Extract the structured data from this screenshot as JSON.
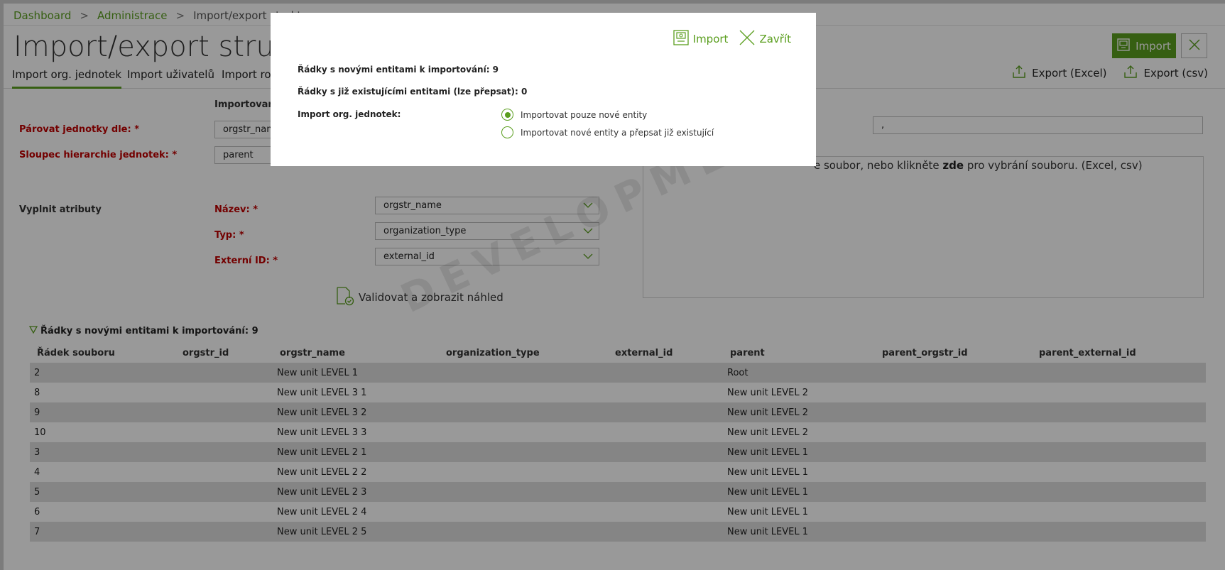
{
  "breadcrumb": {
    "items": [
      "Dashboard",
      "Administrace",
      "Import/export struktury"
    ],
    "separator": ">"
  },
  "page": {
    "title": "Import/export struktury"
  },
  "header_actions": {
    "import_label": "Import"
  },
  "tabs": [
    {
      "label": "Import org. jednotek",
      "active": true
    },
    {
      "label": "Import uživatelů",
      "active": false
    },
    {
      "label": "Import rolí",
      "active": false
    }
  ],
  "exports": {
    "excel_label": "Export (Excel)",
    "csv_label": "Export (csv)"
  },
  "form": {
    "importovany_label": "Importovaný",
    "match_label": "Párovat jednotky dle: *",
    "match_value": "orgstr_name",
    "hierarchy_label": "Sloupec hierarchie jednotek: *",
    "hierarchy_value": "parent",
    "separator_value": ",",
    "fill_attributes_label": "Vyplnit atributy",
    "name_label": "Název: *",
    "name_value": "orgstr_name",
    "type_label": "Typ: *",
    "type_value": "organization_type",
    "extid_label": "Externí ID: *",
    "extid_value": "external_id",
    "validate_label": "Validovat a zobrazit náhled"
  },
  "dropzone": {
    "prefix": "e soubor, nebo klikněte ",
    "link": "zde",
    "suffix": " pro vybrání souboru. (Excel, csv)"
  },
  "preview": {
    "section_title": "Řádky s novými entitami k importování: 9",
    "columns": [
      "Řádek souboru",
      "orgstr_id",
      "orgstr_name",
      "organization_type",
      "external_id",
      "parent",
      "parent_orgstr_id",
      "parent_external_id"
    ],
    "rows": [
      [
        "2",
        "",
        "New unit LEVEL 1",
        "",
        "",
        "Root",
        "",
        ""
      ],
      [
        "8",
        "",
        "New unit LEVEL 3 1",
        "",
        "",
        "New unit LEVEL 2",
        "",
        ""
      ],
      [
        "9",
        "",
        "New unit LEVEL 3 2",
        "",
        "",
        "New unit LEVEL 2",
        "",
        ""
      ],
      [
        "10",
        "",
        "New unit LEVEL 3 3",
        "",
        "",
        "New unit LEVEL 2",
        "",
        ""
      ],
      [
        "3",
        "",
        "New unit LEVEL 2 1",
        "",
        "",
        "New unit LEVEL 1",
        "",
        ""
      ],
      [
        "4",
        "",
        "New unit LEVEL 2 2",
        "",
        "",
        "New unit LEVEL 1",
        "",
        ""
      ],
      [
        "5",
        "",
        "New unit LEVEL 2 3",
        "",
        "",
        "New unit LEVEL 1",
        "",
        ""
      ],
      [
        "6",
        "",
        "New unit LEVEL 2 4",
        "",
        "",
        "New unit LEVEL 1",
        "",
        ""
      ],
      [
        "7",
        "",
        "New unit LEVEL 2 5",
        "",
        "",
        "New unit LEVEL 1",
        "",
        ""
      ]
    ]
  },
  "watermark": "DEVELOPMENT",
  "modal": {
    "import_label": "Import",
    "close_label": "Zavřít",
    "new_rows_text": "Řádky s novými entitami k importování: 9",
    "existing_rows_text": "Řádky s již existujícími entitami (lze přepsat): 0",
    "mode_label": "Import org. jednotek:",
    "options": [
      {
        "label": "Importovat pouze nové entity",
        "selected": true
      },
      {
        "label": "Importovat nové entity a přepsat již existující",
        "selected": false
      }
    ]
  },
  "colors": {
    "accent": "#5a9e1e",
    "required": "#c00000",
    "row_stripe": "#dedede"
  }
}
